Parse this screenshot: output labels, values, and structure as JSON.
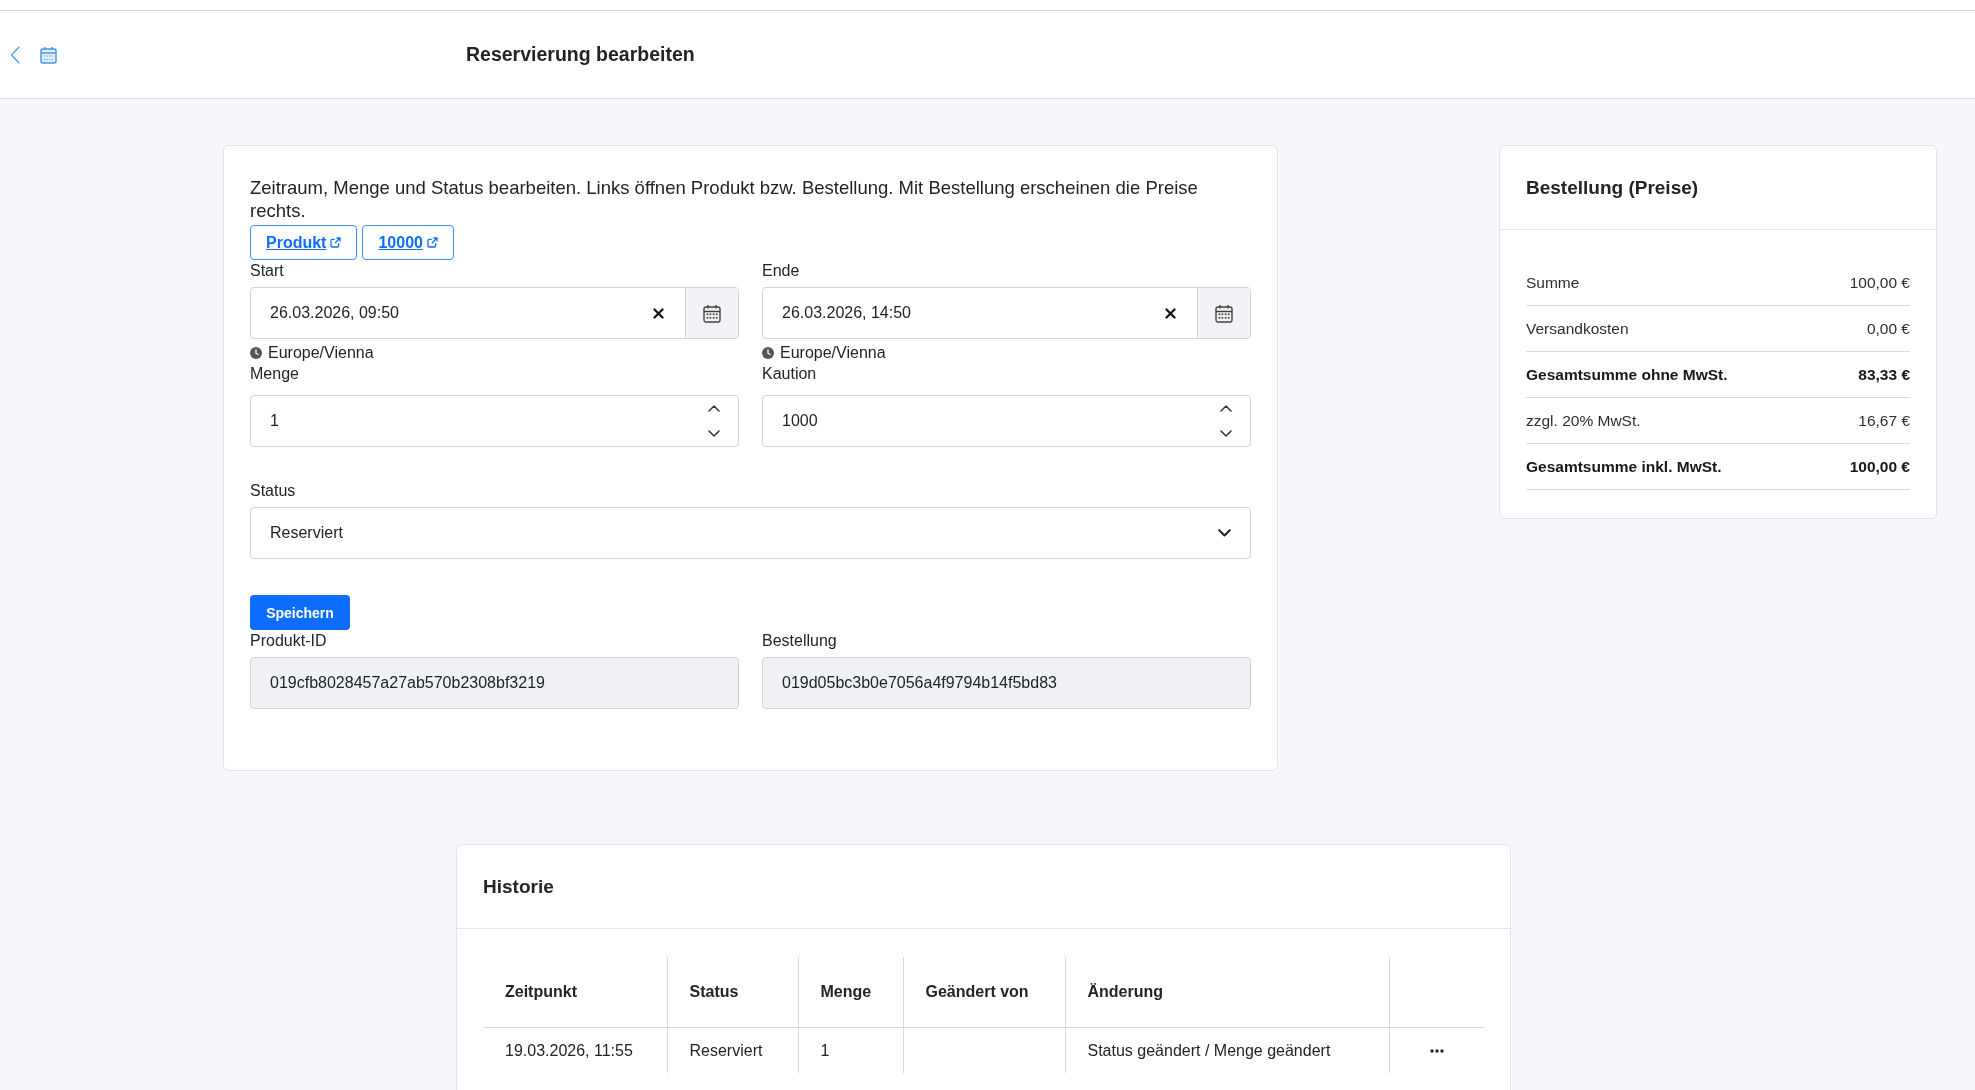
{
  "header": {
    "title": "Reservierung bearbeiten"
  },
  "reservation_form": {
    "description": "Zeitraum, Menge und Status bearbeiten. Links öffnen Produkt bzw. Bestellung. Mit Bestellung erscheinen die Preise rechts.",
    "links": [
      {
        "label": "Produkt"
      },
      {
        "label": "10000"
      }
    ],
    "fields": [
      {
        "kind": "datetime",
        "label": "Start",
        "value": "26.03.2026, 09:50",
        "timezone": "Europe/Vienna"
      },
      {
        "kind": "datetime",
        "label": "Ende",
        "value": "26.03.2026, 14:50",
        "timezone": "Europe/Vienna"
      },
      {
        "kind": "number",
        "label": "Menge",
        "value": "1"
      },
      {
        "kind": "number",
        "label": "Kaution",
        "value": "1000"
      },
      {
        "kind": "select",
        "label": "Status",
        "value": "Reserviert"
      }
    ],
    "save_button": {
      "label": "Speichern"
    },
    "readonly_fields": [
      {
        "label": "Produkt-ID",
        "value": "019cfb8028457a27ab570b2308bf3219"
      },
      {
        "label": "Bestellung",
        "value": "019d05bc3b0e7056a4f9794b14f5bd83"
      }
    ]
  },
  "price_summary": {
    "title": "Bestellung (Preise)",
    "rows": [
      {
        "label": "Summe",
        "value": "100,00 €",
        "emphasized": false
      },
      {
        "label": "Versandkosten",
        "value": "0,00 €",
        "emphasized": false
      },
      {
        "label": "Gesamtsumme ohne MwSt.",
        "value": "83,33 €",
        "emphasized": true
      },
      {
        "label": "zzgl. 20% MwSt.",
        "value": "16,67 €",
        "emphasized": false
      },
      {
        "label": "Gesamtsumme inkl. MwSt.",
        "value": "100,00 €",
        "emphasized": true
      }
    ]
  },
  "history": {
    "title": "Historie",
    "table": {
      "columns": [
        "Zeitpunkt",
        "Status",
        "Menge",
        "Geändert von",
        "Änderung"
      ],
      "rows": [
        {
          "zeitpunkt": "19.03.2026, 11:55",
          "status": "Reserviert",
          "menge": "1",
          "aenderung": "Status geändert / Menge geändert"
        }
      ]
    }
  }
}
